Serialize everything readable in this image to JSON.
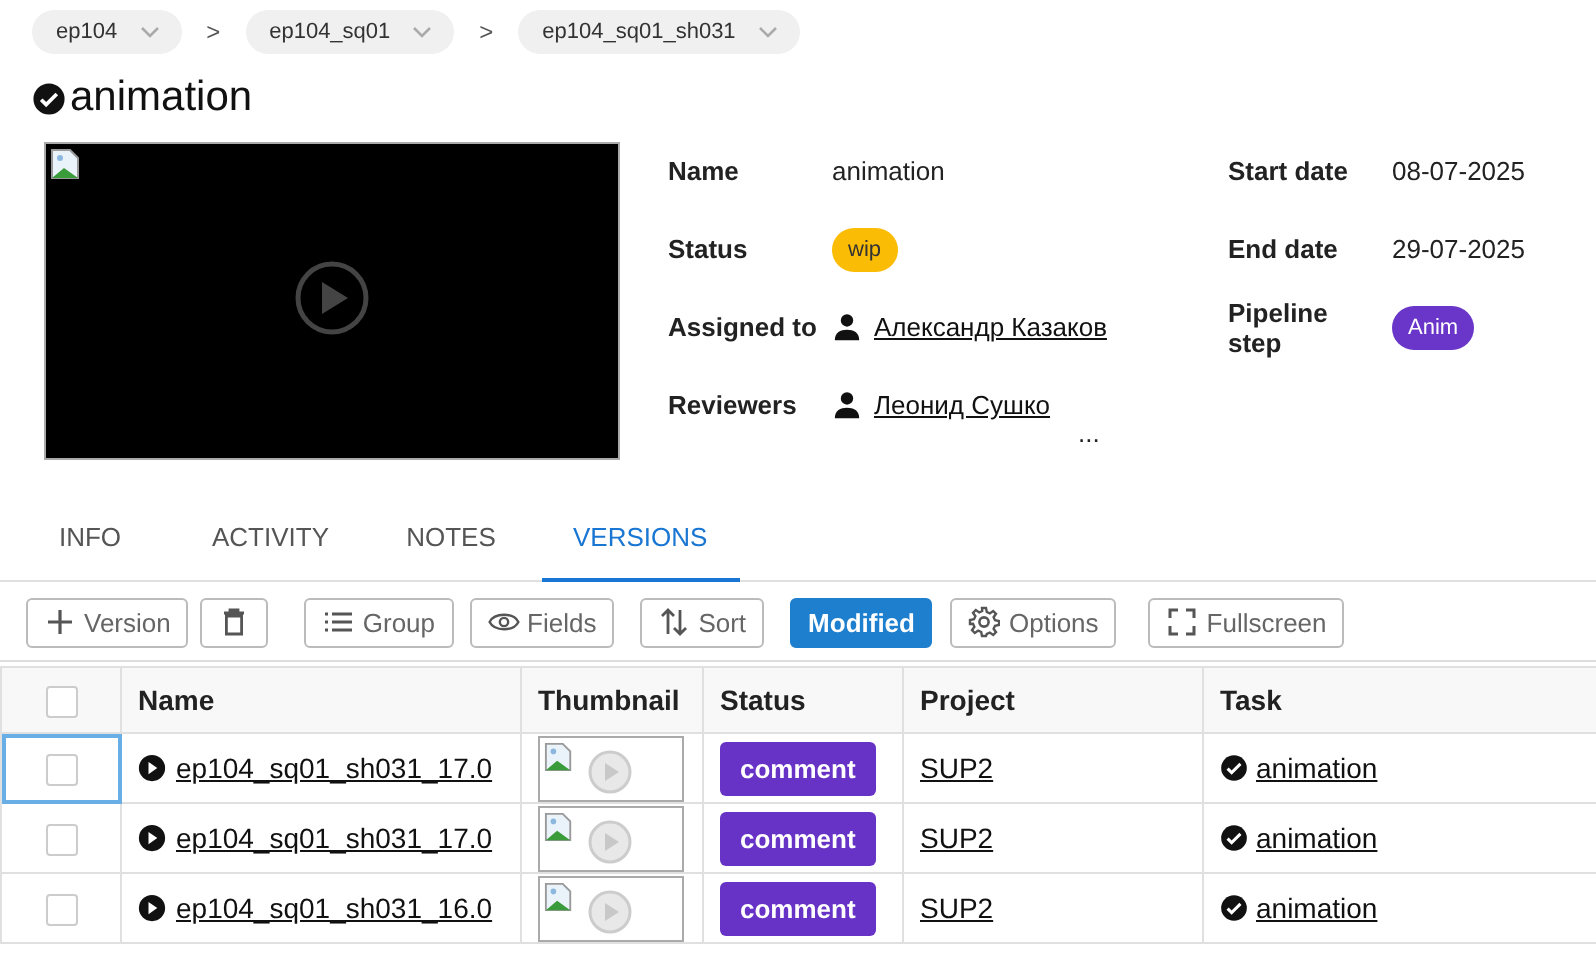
{
  "breadcrumbs": [
    {
      "label": "ep104"
    },
    {
      "label": "ep104_sq01"
    },
    {
      "label": "ep104_sq01_sh031"
    }
  ],
  "breadcrumb_separator": ">",
  "title": "animation",
  "details": [
    [
      {
        "label": "Name",
        "kind": "text",
        "value": "animation"
      },
      {
        "label": "Status",
        "kind": "badge",
        "value": "wip",
        "color": "#fbbc05"
      },
      {
        "label": "Assigned to",
        "kind": "person",
        "value": "Александр Казаков"
      },
      {
        "label": "Reviewers",
        "kind": "person",
        "value": "Леонид Сушко",
        "more": "..."
      }
    ],
    [
      {
        "label": "Start date",
        "kind": "text",
        "value": "08-07-2025"
      },
      {
        "label": "End date",
        "kind": "text",
        "value": "29-07-2025"
      },
      {
        "label": "Pipeline step",
        "kind": "badge",
        "value": "Anim",
        "color": "#6a36c9"
      }
    ]
  ],
  "tabs": [
    {
      "label": "INFO",
      "selected": false
    },
    {
      "label": "ACTIVITY",
      "selected": false
    },
    {
      "label": "NOTES",
      "selected": false
    },
    {
      "label": "VERSIONS",
      "selected": true
    }
  ],
  "toolbar": [
    {
      "label": "Version",
      "active": false
    },
    {
      "active": false
    },
    {
      "label": "Group",
      "active": false
    },
    {
      "label": "Fields",
      "active": false
    },
    {
      "label": "Sort",
      "active": false
    },
    {
      "label": "Modified",
      "active": true
    },
    {
      "label": "Options",
      "active": false
    },
    {
      "label": "Fullscreen",
      "active": false
    }
  ],
  "table": {
    "header_checked": false,
    "columns": [
      "Name",
      "Thumbnail",
      "Status",
      "Project",
      "Task"
    ],
    "rows": [
      {
        "checked": false,
        "focused": true,
        "name": "ep104_sq01_sh031_17.0",
        "status": "comment",
        "color": "#6733c7",
        "project": "SUP2",
        "task": "animation"
      },
      {
        "checked": false,
        "focused": false,
        "name": "ep104_sq01_sh031_17.0",
        "status": "comment",
        "color": "#6733c7",
        "project": "SUP2",
        "task": "animation"
      },
      {
        "checked": false,
        "focused": false,
        "name": "ep104_sq01_sh031_16.0",
        "status": "comment",
        "color": "#6733c7",
        "project": "SUP2",
        "task": "animation"
      }
    ]
  }
}
